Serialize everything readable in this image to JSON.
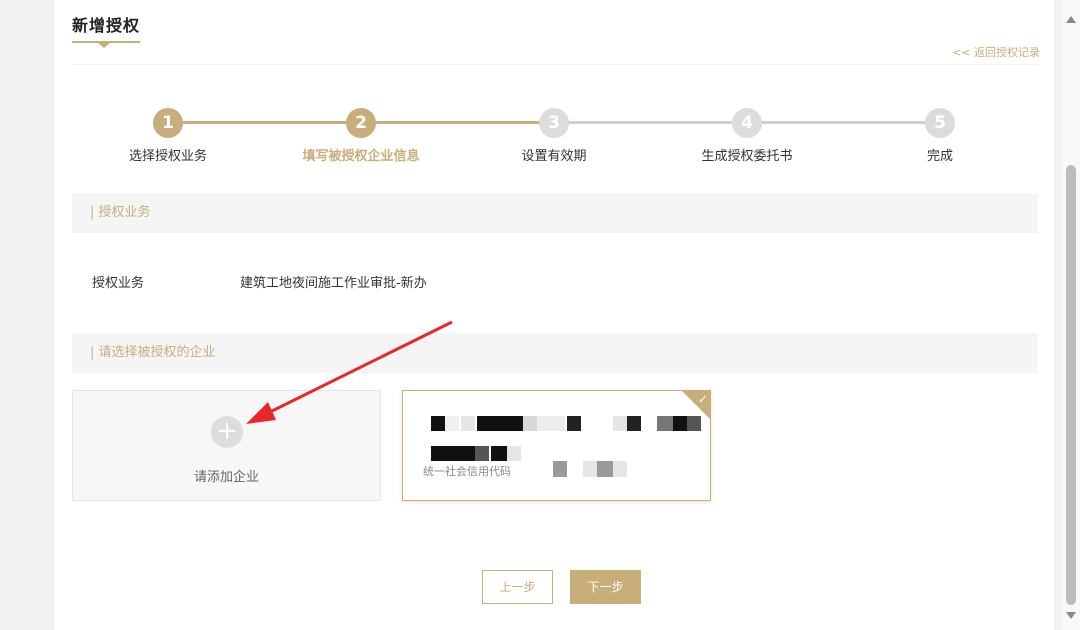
{
  "page": {
    "title": "新增授权",
    "back_link": "<< 返回授权记录"
  },
  "stepper": {
    "steps": [
      {
        "num": "1",
        "label": "选择授权业务",
        "state": "done"
      },
      {
        "num": "2",
        "label": "填写被授权企业信息",
        "state": "active"
      },
      {
        "num": "3",
        "label": "设置有效期",
        "state": "todo"
      },
      {
        "num": "4",
        "label": "生成授权委托书",
        "state": "todo"
      },
      {
        "num": "5",
        "label": "完成",
        "state": "todo"
      }
    ]
  },
  "auth_section": {
    "header": "| 授权业务",
    "label": "授权业务",
    "value": "建筑工地夜间施工作业审批-新办"
  },
  "company_section": {
    "header": "| 请选择被授权的企业"
  },
  "add_company": {
    "icon": "plus-circle-icon",
    "label": "请添加企业"
  },
  "company_card": {
    "credit_label": "统一社会信用代码",
    "selected": true,
    "check_icon": "check-icon"
  },
  "buttons": {
    "prev": "上一步",
    "next": "下一步"
  },
  "colors": {
    "accent": "#c8ae7a",
    "inactive": "#dcdcdc",
    "annotation_arrow": "#e8262b"
  }
}
